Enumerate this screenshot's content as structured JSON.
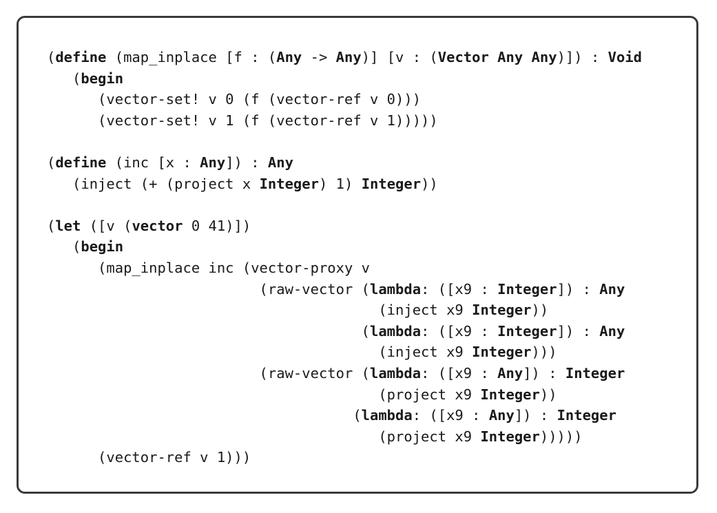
{
  "code": {
    "lines": [
      [
        [
          "(",
          false
        ],
        [
          "define",
          true
        ],
        [
          " (map_inplace [f : (",
          false
        ],
        [
          "Any",
          true
        ],
        [
          " -> ",
          false
        ],
        [
          "Any",
          true
        ],
        [
          ")] [v : (",
          false
        ],
        [
          "Vector Any Any",
          true
        ],
        [
          ")]) : ",
          false
        ],
        [
          "Void",
          true
        ]
      ],
      [
        [
          "   (",
          false
        ],
        [
          "begin",
          true
        ]
      ],
      [
        [
          "      (vector-set! v 0 (f (vector-ref v 0)))",
          false
        ]
      ],
      [
        [
          "      (vector-set! v 1 (f (vector-ref v 1)))))",
          false
        ]
      ],
      [],
      [
        [
          "(",
          false
        ],
        [
          "define",
          true
        ],
        [
          " (inc [x : ",
          false
        ],
        [
          "Any",
          true
        ],
        [
          "]) : ",
          false
        ],
        [
          "Any",
          true
        ]
      ],
      [
        [
          "   (inject (+ (project x ",
          false
        ],
        [
          "Integer",
          true
        ],
        [
          ") 1) ",
          false
        ],
        [
          "Integer",
          true
        ],
        [
          "))",
          false
        ]
      ],
      [],
      [
        [
          "(",
          false
        ],
        [
          "let",
          true
        ],
        [
          " ([v (",
          false
        ],
        [
          "vector",
          true
        ],
        [
          " 0 41)])",
          false
        ]
      ],
      [
        [
          "   (",
          false
        ],
        [
          "begin",
          true
        ]
      ],
      [
        [
          "      (map_inplace inc (vector-proxy v",
          false
        ]
      ],
      [
        [
          "                         (raw-vector (",
          false
        ],
        [
          "lambda",
          true
        ],
        [
          ": ([x9 : ",
          false
        ],
        [
          "Integer",
          true
        ],
        [
          "]) : ",
          false
        ],
        [
          "Any",
          true
        ]
      ],
      [
        [
          "                                       (inject x9 ",
          false
        ],
        [
          "Integer",
          true
        ],
        [
          "))",
          false
        ]
      ],
      [
        [
          "                                     (",
          false
        ],
        [
          "lambda",
          true
        ],
        [
          ": ([x9 : ",
          false
        ],
        [
          "Integer",
          true
        ],
        [
          "]) : ",
          false
        ],
        [
          "Any",
          true
        ]
      ],
      [
        [
          "                                       (inject x9 ",
          false
        ],
        [
          "Integer",
          true
        ],
        [
          ")))",
          false
        ]
      ],
      [
        [
          "                         (raw-vector (",
          false
        ],
        [
          "lambda",
          true
        ],
        [
          ": ([x9 : ",
          false
        ],
        [
          "Any",
          true
        ],
        [
          "]) : ",
          false
        ],
        [
          "Integer",
          true
        ]
      ],
      [
        [
          "                                       (project x9 ",
          false
        ],
        [
          "Integer",
          true
        ],
        [
          "))",
          false
        ]
      ],
      [
        [
          "                                    (",
          false
        ],
        [
          "lambda",
          true
        ],
        [
          ": ([x9 : ",
          false
        ],
        [
          "Any",
          true
        ],
        [
          "]) : ",
          false
        ],
        [
          "Integer",
          true
        ]
      ],
      [
        [
          "                                       (project x9 ",
          false
        ],
        [
          "Integer",
          true
        ],
        [
          ")))))",
          false
        ]
      ],
      [
        [
          "      (vector-ref v 1)))",
          false
        ]
      ]
    ]
  }
}
